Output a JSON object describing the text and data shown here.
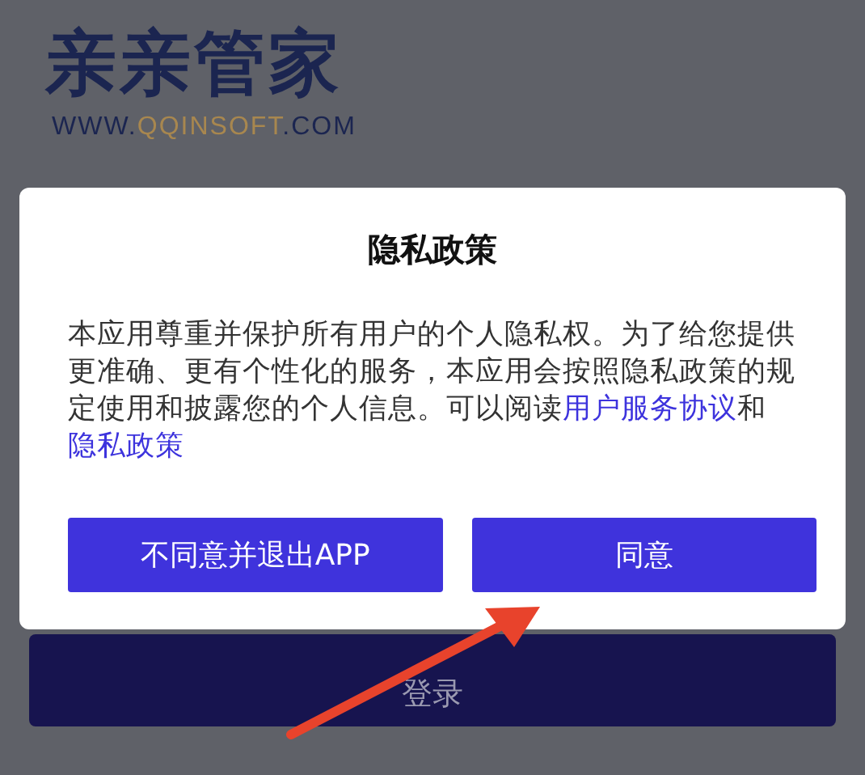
{
  "logo": {
    "name": "亲亲管家",
    "url_parts": [
      {
        "text": "WWW.",
        "kind": "plain"
      },
      {
        "text": "QQINSOFT",
        "kind": "accent"
      },
      {
        "text": ".COM",
        "kind": "plain"
      }
    ]
  },
  "dialog": {
    "title": "隐私政策",
    "body": [
      {
        "text": "本应用尊重并保护所有用户的个人隐私权。为了给您提供更准确、更有个性化的服务，本应用会按照隐私政策的规定使用和披露您的个人信息。可以阅读",
        "kind": "plain"
      },
      {
        "text": "用户服务协议",
        "kind": "link"
      },
      {
        "text": "和",
        "kind": "plain"
      },
      {
        "text": "隐私政策",
        "kind": "link"
      }
    ],
    "buttons": [
      {
        "label": "不同意并退出APP",
        "kind": "decline"
      },
      {
        "label": "同意",
        "kind": "accept"
      }
    ]
  },
  "login_button": {
    "label": "登录"
  }
}
